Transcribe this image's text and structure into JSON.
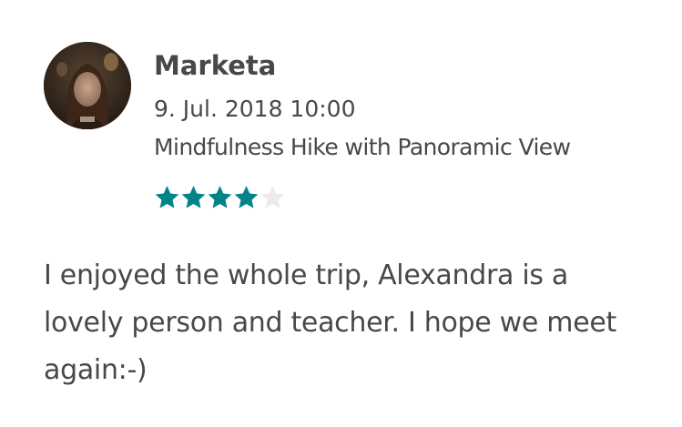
{
  "review": {
    "author": "Marketa",
    "date": "9. Jul. 2018 10:00",
    "experience": "Mindfulness Hike with Panoramic View",
    "rating": 4,
    "rating_max": 5,
    "text": "I enjoyed the whole trip, Alexandra is a lovely person and teacher. I hope we meet again:-)"
  },
  "colors": {
    "star_filled": "#008489",
    "star_empty": "#EBEBEB",
    "text": "#484848"
  },
  "icons": {
    "avatar": "user-avatar-photo",
    "star": "star-icon"
  }
}
